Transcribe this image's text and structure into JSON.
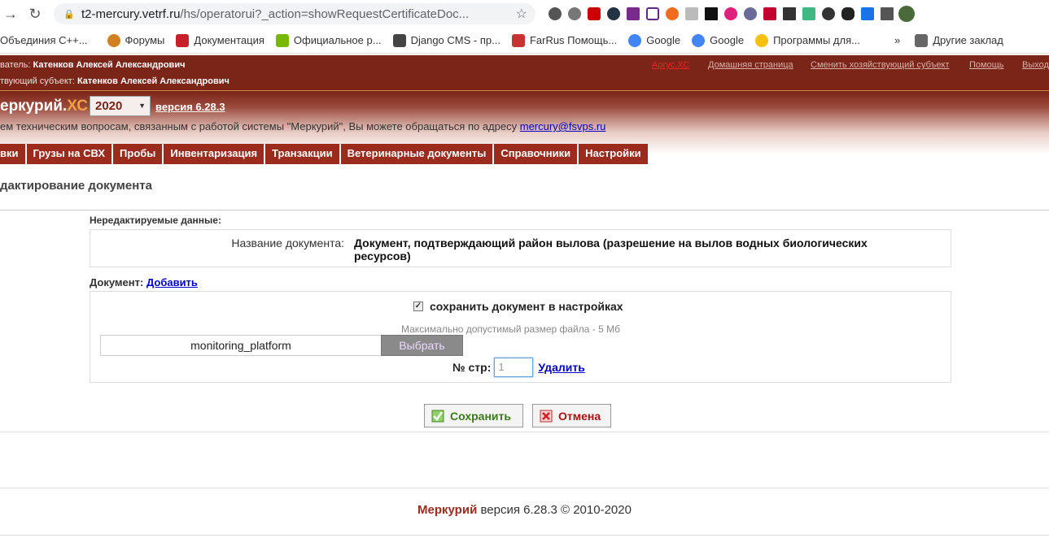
{
  "browser": {
    "url_host": "t2-mercury.vetrf.ru",
    "url_path": "/hs/operatorui?_action=showRequestCertificateDoc...",
    "bookmarks": [
      {
        "label": "Объединия С++...",
        "icon": "code-icon",
        "color": "#8b2be2"
      },
      {
        "label": "Форумы",
        "icon": "globe-icon",
        "color": "#d08020"
      },
      {
        "label": "Документация",
        "icon": "book-icon",
        "color": "#c8202a"
      },
      {
        "label": "Официальное р...",
        "icon": "nvidia-icon",
        "color": "#76b900"
      },
      {
        "label": "Django CMS - пр...",
        "icon": "cms-icon",
        "color": "#444444"
      },
      {
        "label": "FarRus Помощь...",
        "icon": "tools-icon",
        "color": "#c83232"
      },
      {
        "label": "Google",
        "icon": "google-icon",
        "color": "#4285f4"
      },
      {
        "label": "Google",
        "icon": "google-icon",
        "color": "#4285f4"
      },
      {
        "label": "Программы для...",
        "icon": "bulb-icon",
        "color": "#f4c20d"
      }
    ],
    "more_bookmarks": "»",
    "other_bookmarks": "Другие заклад"
  },
  "header": {
    "user_label": "ватель:",
    "user_name": "Катенков Алексей Александрович",
    "entity_label": "твующий субъект:",
    "entity_name": "Катенков Алексей Александрович",
    "links": [
      "Аргус.ХС",
      "Домашняя страница",
      "Сменить хозяйствующий субъект",
      "Помощь",
      "Выход"
    ],
    "logo_main": "еркурий.",
    "logo_suffix": "ХС",
    "year": "2020",
    "version": "версия 6.28.3",
    "support_text": "ем техническим вопросам, связанным с работой системы \"Меркурий\", Вы можете обращаться по адресу",
    "support_email": "mercury@fsvps.ru"
  },
  "menu": [
    "вки",
    "Грузы на СВХ",
    "Пробы",
    "Инвентаризация",
    "Транзакции",
    "Ветеринарные документы",
    "Справочники",
    "Настройки"
  ],
  "page": {
    "title": "дактирование документа",
    "readonly_label": "Нередактируемые данные:",
    "doc_name_label": "Название документа:",
    "doc_name_value": "Документ, подтверждающий район вылова (разрешение на вылов водных биологических ресурсов)",
    "document_label": "Документ:",
    "add_link": "Добавить",
    "save_checkbox_label": "сохранить документ в настройках",
    "max_size": "Максимально допустимый размер файла - 5 Мб",
    "file_name": "monitoring_platform",
    "choose_button": "Выбрать",
    "page_no_label": "№ стр:",
    "page_no_placeholder": "1",
    "delete_link": "Удалить",
    "save_button": "Сохранить",
    "cancel_button": "Отмена"
  },
  "footer": {
    "brand": "Меркурий",
    "text": "версия 6.28.3 © 2010-2020"
  }
}
